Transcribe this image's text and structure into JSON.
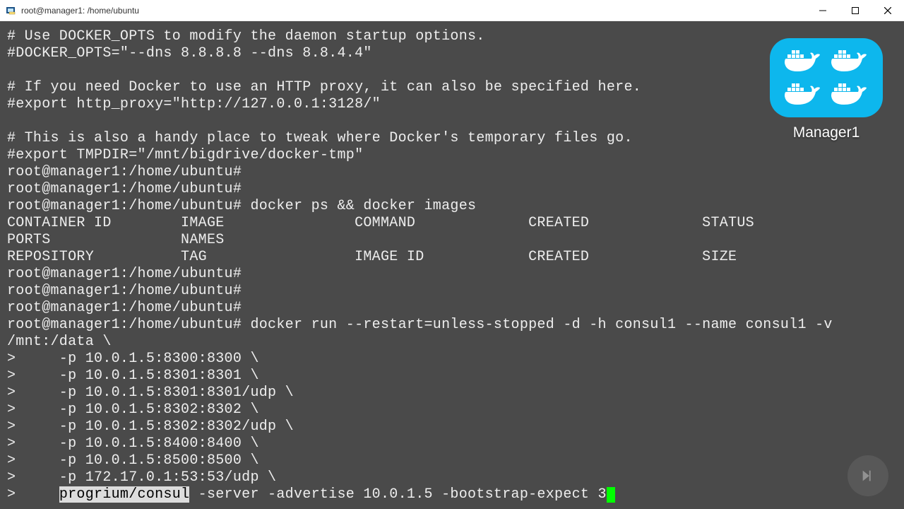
{
  "window": {
    "title": "root@manager1: /home/ubuntu"
  },
  "badge": {
    "label": "Manager1"
  },
  "terminal": {
    "line1": "# Use DOCKER_OPTS to modify the daemon startup options.",
    "line2": "#DOCKER_OPTS=\"--dns 8.8.8.8 --dns 8.8.4.4\"",
    "blank1": "",
    "line3": "# If you need Docker to use an HTTP proxy, it can also be specified here.",
    "line4": "#export http_proxy=\"http://127.0.0.1:3128/\"",
    "blank2": "",
    "line5": "# This is also a handy place to tweak where Docker's temporary files go.",
    "line6": "#export TMPDIR=\"/mnt/bigdrive/docker-tmp\"",
    "prompt1": "root@manager1:/home/ubuntu#",
    "prompt2": "root@manager1:/home/ubuntu#",
    "prompt3": "root@manager1:/home/ubuntu# docker ps && docker images",
    "header1": "CONTAINER ID        IMAGE               COMMAND             CREATED             STATUS              PORTS               NAMES",
    "header2": "REPOSITORY          TAG                 IMAGE ID            CREATED             SIZE",
    "prompt4": "root@manager1:/home/ubuntu#",
    "prompt5": "root@manager1:/home/ubuntu#",
    "prompt6": "root@manager1:/home/ubuntu#",
    "cmd_start": "root@manager1:/home/ubuntu# docker run --restart=unless-stopped -d -h consul1 --name consul1 -v /mnt:/data \\",
    "c1": ">     -p 10.0.1.5:8300:8300 \\",
    "c2": ">     -p 10.0.1.5:8301:8301 \\",
    "c3": ">     -p 10.0.1.5:8301:8301/udp \\",
    "c4": ">     -p 10.0.1.5:8302:8302 \\",
    "c5": ">     -p 10.0.1.5:8302:8302/udp \\",
    "c6": ">     -p 10.0.1.5:8400:8400 \\",
    "c7": ">     -p 10.0.1.5:8500:8500 \\",
    "c8": ">     -p 172.17.0.1:53:53/udp \\",
    "c9_prefix": ">     ",
    "c9_sel": "progrium/consul",
    "c9_rest": " -server -advertise 10.0.1.5 -bootstrap-expect 3"
  }
}
